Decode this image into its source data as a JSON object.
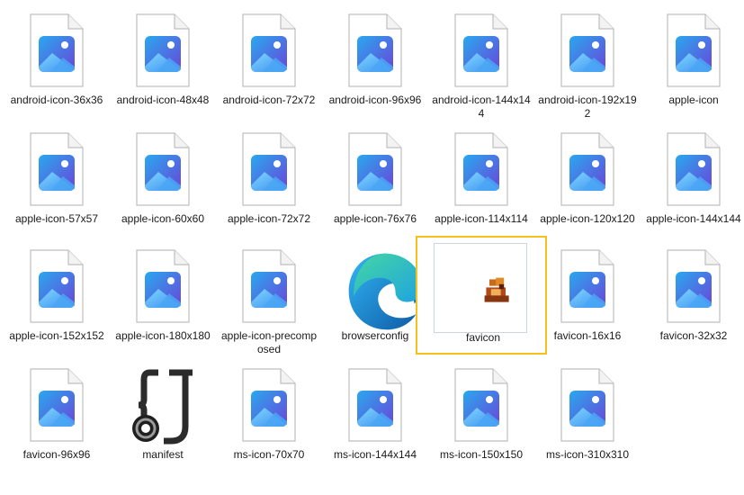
{
  "files": [
    {
      "name": "android-icon-36x36",
      "kind": "image"
    },
    {
      "name": "android-icon-48x48",
      "kind": "image"
    },
    {
      "name": "android-icon-72x72",
      "kind": "image"
    },
    {
      "name": "android-icon-96x96",
      "kind": "image"
    },
    {
      "name": "android-icon-144x144",
      "kind": "image"
    },
    {
      "name": "android-icon-192x192",
      "kind": "image"
    },
    {
      "name": "apple-icon",
      "kind": "image"
    },
    {
      "name": "apple-icon-57x57",
      "kind": "image"
    },
    {
      "name": "apple-icon-60x60",
      "kind": "image"
    },
    {
      "name": "apple-icon-72x72",
      "kind": "image"
    },
    {
      "name": "apple-icon-76x76",
      "kind": "image"
    },
    {
      "name": "apple-icon-114x114",
      "kind": "image"
    },
    {
      "name": "apple-icon-120x120",
      "kind": "image"
    },
    {
      "name": "apple-icon-144x144",
      "kind": "image"
    },
    {
      "name": "apple-icon-152x152",
      "kind": "image"
    },
    {
      "name": "apple-icon-180x180",
      "kind": "image"
    },
    {
      "name": "apple-icon-precomposed",
      "kind": "image"
    },
    {
      "name": "browserconfig",
      "kind": "edge"
    },
    {
      "name": "favicon",
      "kind": "ico",
      "selected": true
    },
    {
      "name": "favicon-16x16",
      "kind": "image"
    },
    {
      "name": "favicon-32x32",
      "kind": "image"
    },
    {
      "name": "favicon-96x96",
      "kind": "image"
    },
    {
      "name": "manifest",
      "kind": "json"
    },
    {
      "name": "ms-icon-70x70",
      "kind": "image"
    },
    {
      "name": "ms-icon-144x144",
      "kind": "image"
    },
    {
      "name": "ms-icon-150x150",
      "kind": "image"
    },
    {
      "name": "ms-icon-310x310",
      "kind": "image"
    }
  ],
  "colors": {
    "selection_border": "#f5c11a",
    "image_icon_blue": "#2f7de1",
    "image_icon_purple": "#6b4fd6"
  }
}
